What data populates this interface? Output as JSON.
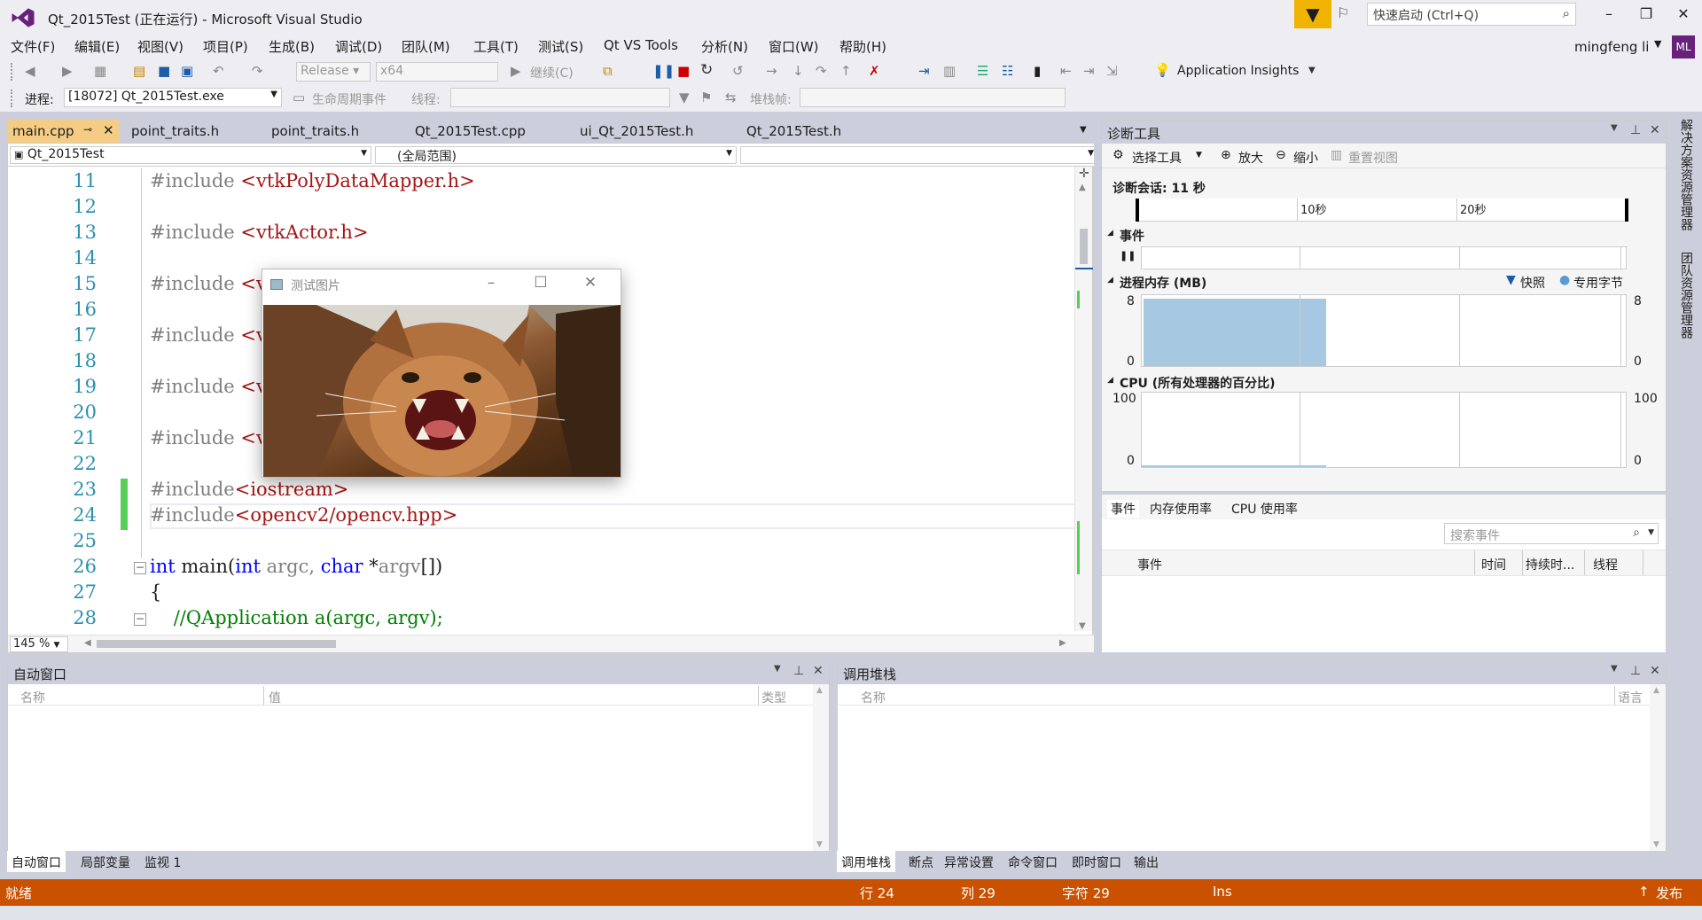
{
  "window": {
    "title": "Qt_2015Test (正在运行) - Microsoft Visual Studio"
  },
  "quick_launch": {
    "placeholder": "快速启动 (Ctrl+Q)"
  },
  "menu": [
    "文件(F)",
    "编辑(E)",
    "视图(V)",
    "项目(P)",
    "生成(B)",
    "调试(D)",
    "团队(M)",
    "工具(T)",
    "测试(S)",
    "Qt VS Tools",
    "分析(N)",
    "窗口(W)",
    "帮助(H)"
  ],
  "user": {
    "name": "mingfeng li",
    "initials": "ML"
  },
  "toolbar": {
    "config": "Release",
    "platform": "x64",
    "continue": "继续(C)",
    "insights": "Application Insights",
    "process_label": "进程:",
    "process_value": "[18072] Qt_2015Test.exe",
    "lifecycle": "生命周期事件",
    "thread_label": "线程:",
    "stackframe_label": "堆栈帧:"
  },
  "tabs": [
    "main.cpp",
    "point_traits.h",
    "point_traits.h",
    "Qt_2015Test.cpp",
    "ui_Qt_2015Test.h",
    "Qt_2015Test.h"
  ],
  "editor": {
    "project": "Qt_2015Test",
    "scope": "(全局范围)",
    "zoom": "145 %",
    "line_numbers": [
      "11",
      "12",
      "13",
      "14",
      "15",
      "16",
      "17",
      "18",
      "19",
      "20",
      "21",
      "22",
      "23",
      "24",
      "25",
      "26",
      "27",
      "28"
    ]
  },
  "image_window": {
    "title": "测试图片"
  },
  "diag": {
    "title": "诊断工具",
    "select_tool": "选择工具",
    "zoom_in": "放大",
    "zoom_out": "缩小",
    "reset_view": "重置视图",
    "session": "诊断会话: 11 秒",
    "tick_10": "10秒",
    "tick_20": "20秒",
    "events_label": "事件",
    "memory_label": "进程内存 (MB)",
    "snapshot_legend": "快照",
    "private_bytes_legend": "专用字节",
    "mem_max": "8",
    "mem_min": "0",
    "cpu_label": "CPU (所有处理器的百分比)",
    "cpu_max": "100",
    "cpu_min": "0",
    "bottom_tabs": [
      "事件",
      "内存使用率",
      "CPU 使用率"
    ],
    "search_placeholder": "搜索事件",
    "columns": [
      "事件",
      "时间",
      "持续时...",
      "线程"
    ],
    "memory_fill": 0.95
  },
  "autos": {
    "title": "自动窗口",
    "columns": [
      "名称",
      "值",
      "类型"
    ],
    "tabs": [
      "自动窗口",
      "局部变量",
      "监视 1"
    ]
  },
  "callstack": {
    "title": "调用堆栈",
    "columns": [
      "名称",
      "语言"
    ],
    "tabs": [
      "调用堆栈",
      "断点",
      "异常设置",
      "命令窗口",
      "即时窗口",
      "输出"
    ]
  },
  "status": {
    "ready": "就绪",
    "line": "行 24",
    "col": "列 29",
    "char": "字符 29",
    "ins": "Ins",
    "publish": "发布"
  },
  "side_panels": [
    "解决方案资源管理器",
    "团队资源管理器"
  ],
  "colors": {
    "accent": "#ca5100",
    "tab_active": "#f5cc84",
    "brand": "#68217a"
  }
}
